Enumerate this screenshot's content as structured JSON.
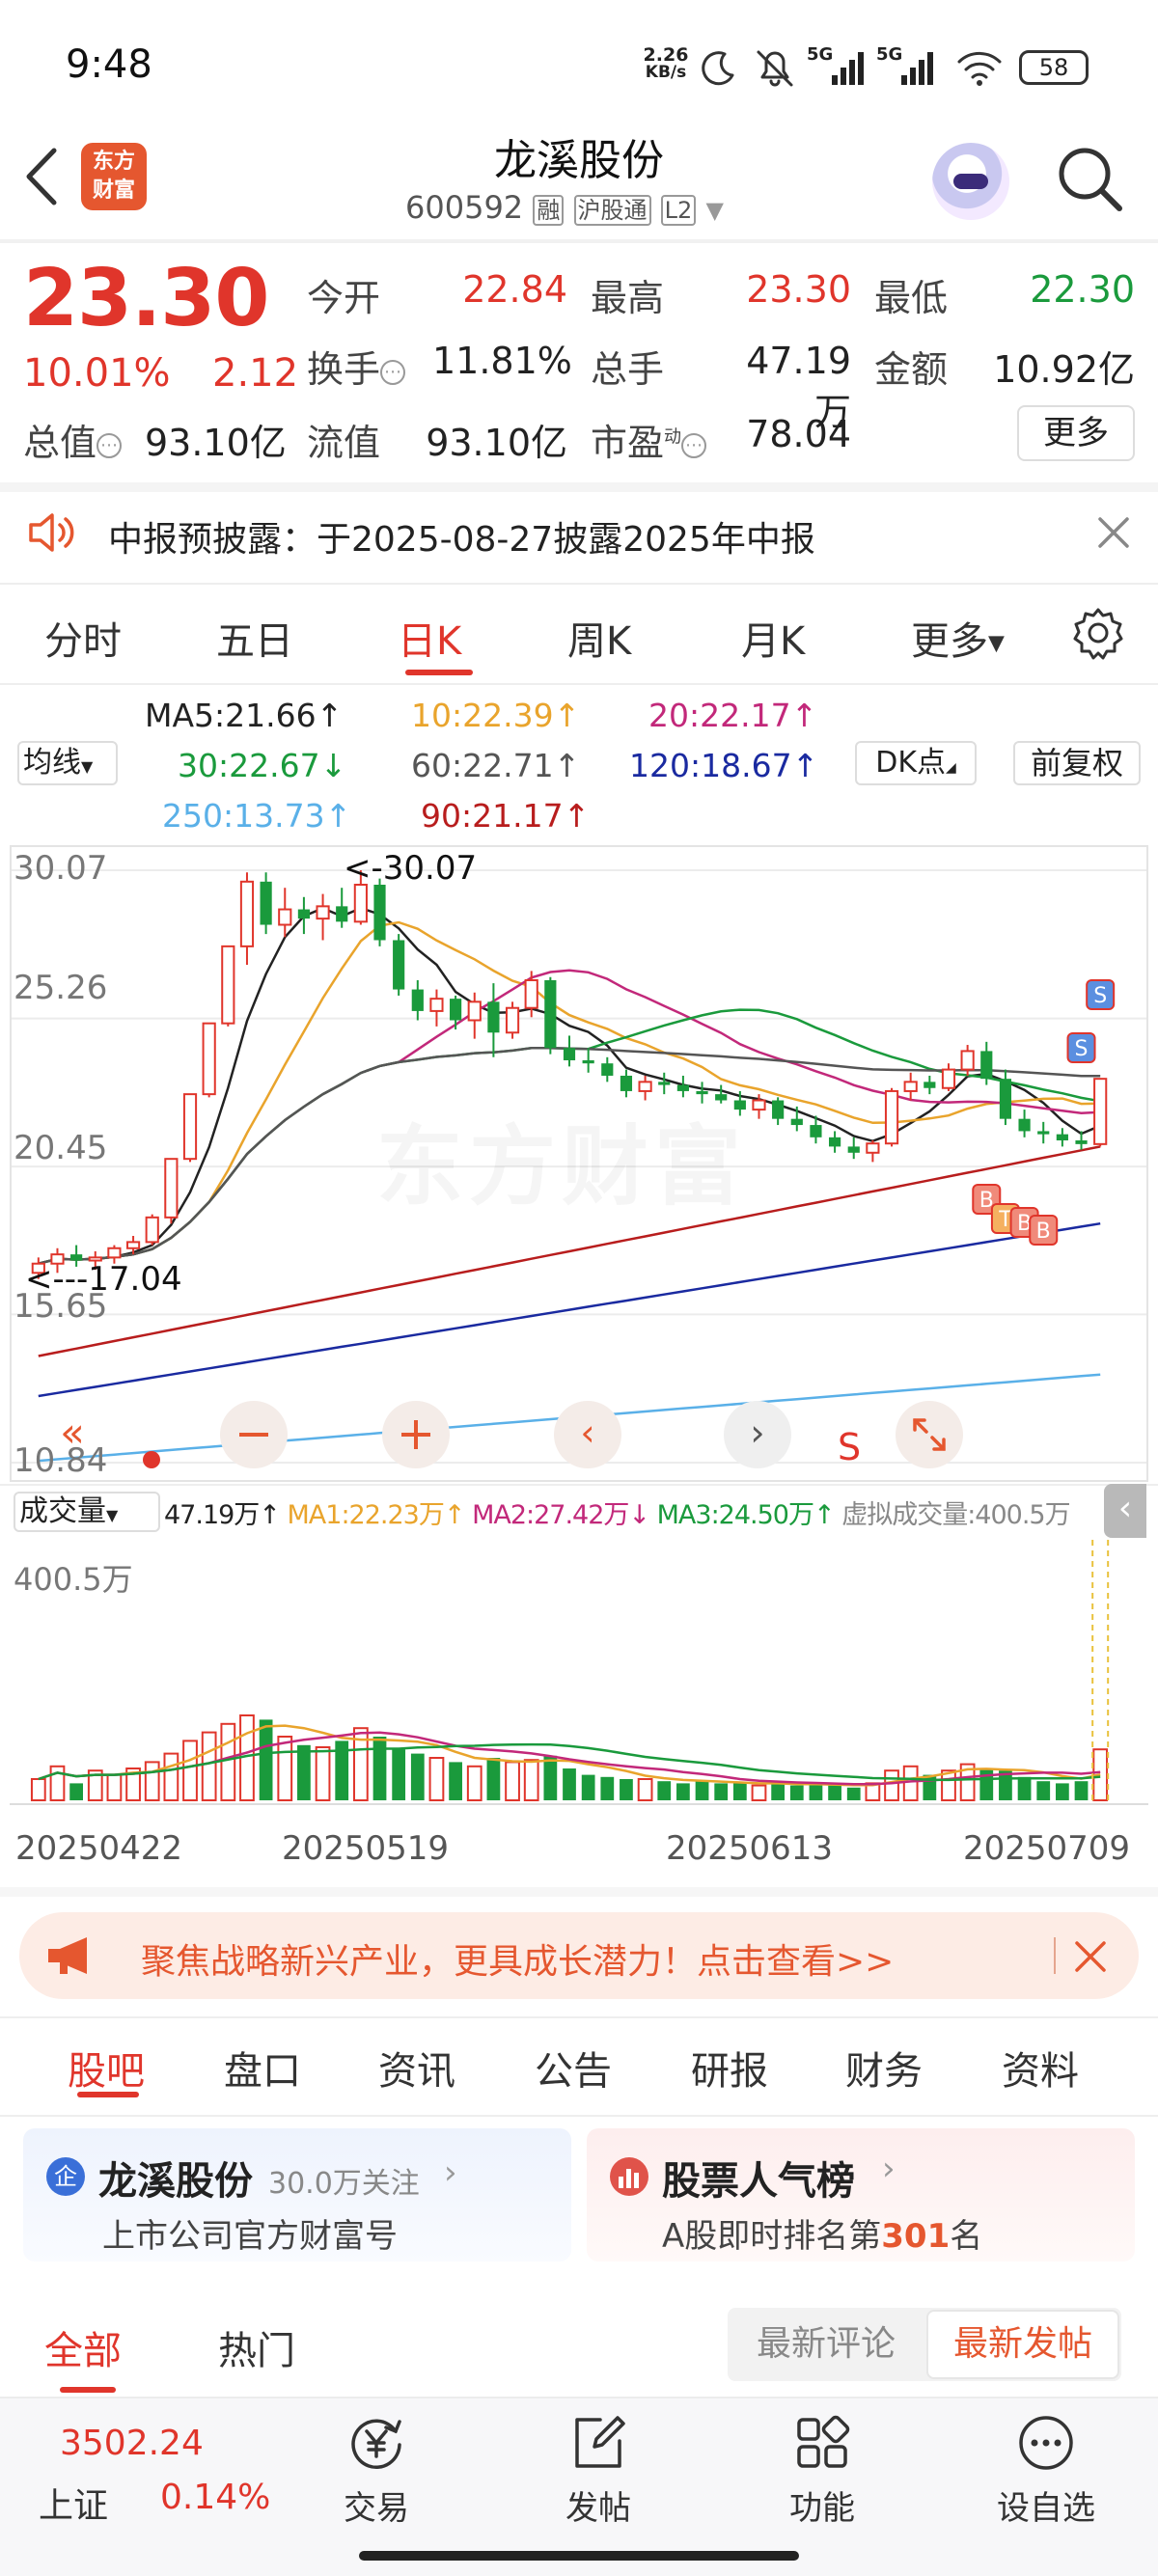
{
  "status_bar": {
    "time": "9:48",
    "net_speed_top": "2.26",
    "net_speed_bottom": "KB/s",
    "battery": "58",
    "sig1": "5G",
    "sig2": "5G"
  },
  "header": {
    "app_logo_top": "东方",
    "app_logo_bottom": "财富",
    "stock_name": "龙溪股份",
    "stock_code": "600592",
    "tag_rong": "融",
    "tag_hgt": "沪股通",
    "tag_l2": "L2"
  },
  "quote": {
    "price": "23.30",
    "change_pct": "10.01%",
    "change_amt": "2.12",
    "open_label": "今开",
    "open": "22.84",
    "high_label": "最高",
    "high": "23.30",
    "low_label": "最低",
    "low": "22.30",
    "turnover_label": "换手",
    "turnover": "11.81%",
    "volume_label": "总手",
    "volume": "47.19万",
    "amount_label": "金额",
    "amount": "10.92亿",
    "mcap_label": "总值",
    "mcap": "93.10亿",
    "float_label": "流值",
    "float": "93.10亿",
    "pe_label": "市盈",
    "pe_sup": "动",
    "pe": "78.04",
    "more_button": "更多"
  },
  "notice": {
    "text": "中报预披露：于2025-08-27披露2025年中报"
  },
  "period_tabs": [
    "分时",
    "五日",
    "日K",
    "周K",
    "月K",
    "更多"
  ],
  "active_tab": "日K",
  "ma": {
    "ma_type": "均线",
    "ma5": "MA5:21.66↑",
    "ma10": "10:22.39↑",
    "ma20": "20:22.17↑",
    "ma30": "30:22.67↓",
    "ma60": "60:22.71↑",
    "ma120": "120:18.67↑",
    "ma250": "250:13.73↑",
    "ma90": "90:21.17↑",
    "dk_button": "DK点",
    "adjust_button": "前复权"
  },
  "chart_data": {
    "type": "candlestick",
    "price_axis_ticks": [
      "30.07",
      "25.26",
      "20.45",
      "15.65",
      "10.84"
    ],
    "ylim": [
      10.84,
      30.07
    ],
    "max_marker": "<-30.07",
    "min_marker": "<---17.04",
    "watermark": "东方财富",
    "date_labels": [
      "20250422",
      "20250519",
      "20250613",
      "20250709"
    ],
    "candles": [
      [
        17.0,
        17.5,
        16.8,
        17.3
      ],
      [
        17.3,
        17.8,
        17.0,
        17.6
      ],
      [
        17.6,
        17.9,
        17.2,
        17.4
      ],
      [
        17.4,
        17.7,
        17.1,
        17.5
      ],
      [
        17.5,
        17.9,
        17.3,
        17.8
      ],
      [
        17.8,
        18.2,
        17.6,
        18.0
      ],
      [
        18.0,
        18.9,
        17.9,
        18.8
      ],
      [
        18.8,
        20.7,
        18.6,
        20.7
      ],
      [
        20.7,
        22.8,
        20.6,
        22.8
      ],
      [
        22.8,
        25.1,
        22.7,
        25.1
      ],
      [
        25.1,
        27.6,
        25.0,
        27.6
      ],
      [
        27.6,
        30.0,
        27.0,
        29.7
      ],
      [
        29.7,
        30.0,
        28.0,
        28.3
      ],
      [
        28.3,
        29.5,
        27.9,
        28.8
      ],
      [
        28.8,
        29.2,
        28.0,
        28.5
      ],
      [
        28.5,
        29.3,
        27.8,
        28.9
      ],
      [
        28.9,
        29.5,
        28.2,
        28.4
      ],
      [
        28.4,
        30.07,
        28.3,
        29.6
      ],
      [
        29.6,
        29.8,
        27.6,
        27.8
      ],
      [
        27.8,
        28.0,
        26.0,
        26.2
      ],
      [
        26.2,
        26.5,
        25.2,
        25.5
      ],
      [
        25.5,
        26.2,
        25.0,
        25.9
      ],
      [
        25.9,
        26.0,
        24.9,
        25.2
      ],
      [
        25.2,
        26.1,
        24.6,
        25.8
      ],
      [
        25.8,
        26.4,
        24.0,
        24.8
      ],
      [
        24.8,
        25.8,
        24.6,
        25.6
      ],
      [
        25.6,
        26.8,
        25.3,
        26.5
      ],
      [
        26.5,
        26.6,
        24.1,
        24.3
      ],
      [
        24.3,
        24.7,
        23.7,
        23.9
      ],
      [
        23.9,
        24.3,
        23.5,
        23.8
      ],
      [
        23.8,
        24.0,
        23.2,
        23.4
      ],
      [
        23.4,
        23.6,
        22.7,
        22.9
      ],
      [
        22.9,
        23.4,
        22.6,
        23.2
      ],
      [
        23.2,
        23.5,
        22.8,
        23.1
      ],
      [
        23.1,
        23.4,
        22.7,
        22.9
      ],
      [
        22.9,
        23.2,
        22.5,
        22.8
      ],
      [
        22.8,
        23.1,
        22.5,
        22.6
      ],
      [
        22.6,
        22.9,
        22.1,
        22.3
      ],
      [
        22.3,
        22.8,
        22.0,
        22.6
      ],
      [
        22.6,
        22.7,
        21.8,
        22.0
      ],
      [
        22.0,
        22.4,
        21.6,
        21.8
      ],
      [
        21.8,
        22.1,
        21.2,
        21.4
      ],
      [
        21.4,
        21.6,
        20.9,
        21.1
      ],
      [
        21.1,
        21.4,
        20.7,
        20.9
      ],
      [
        20.9,
        21.3,
        20.6,
        21.2
      ],
      [
        21.2,
        23.0,
        21.1,
        22.9
      ],
      [
        22.9,
        23.5,
        22.6,
        23.2
      ],
      [
        23.2,
        23.4,
        22.8,
        23.0
      ],
      [
        23.0,
        23.8,
        22.9,
        23.6
      ],
      [
        23.6,
        24.4,
        23.4,
        24.2
      ],
      [
        24.2,
        24.5,
        23.1,
        23.3
      ],
      [
        23.3,
        23.6,
        21.8,
        22.0
      ],
      [
        22.0,
        22.3,
        21.4,
        21.6
      ],
      [
        21.6,
        21.9,
        21.2,
        21.5
      ],
      [
        21.5,
        21.7,
        21.1,
        21.3
      ],
      [
        21.3,
        21.6,
        21.0,
        21.18
      ],
      [
        21.18,
        23.3,
        21.1,
        23.3
      ]
    ]
  },
  "chart_controls": {
    "s_marker": "S"
  },
  "volume": {
    "label": "成交量",
    "vol": "47.19万↑",
    "ma1": "MA1:22.23万↑",
    "ma2": "MA2:27.42万↓",
    "ma3": "MA3:24.50万↑",
    "virtual": "虚拟成交量:400.5万",
    "max_tick": "400.5万",
    "bars": [
      0.1,
      0.16,
      0.08,
      0.14,
      0.12,
      0.15,
      0.18,
      0.22,
      0.28,
      0.32,
      0.36,
      0.4,
      0.38,
      0.3,
      0.26,
      0.25,
      0.28,
      0.34,
      0.3,
      0.24,
      0.22,
      0.2,
      0.18,
      0.16,
      0.2,
      0.18,
      0.19,
      0.21,
      0.15,
      0.12,
      0.11,
      0.1,
      0.1,
      0.09,
      0.08,
      0.09,
      0.08,
      0.08,
      0.07,
      0.08,
      0.07,
      0.08,
      0.07,
      0.06,
      0.08,
      0.14,
      0.16,
      0.12,
      0.14,
      0.17,
      0.15,
      0.14,
      0.11,
      0.09,
      0.08,
      0.09,
      0.24
    ]
  },
  "banner": {
    "text": "聚焦战略新兴产业，更具成长潜力！点击查看>>"
  },
  "section_tabs": [
    "股吧",
    "盘口",
    "资讯",
    "公告",
    "研报",
    "财务",
    "资料"
  ],
  "cards": {
    "official": {
      "name": "龙溪股份",
      "followers": "30.0万关注",
      "desc": "上市公司官方财富号"
    },
    "rank": {
      "title": "股票人气榜",
      "desc_prefix": "A股即时排名第",
      "rank": "301",
      "desc_suffix": "名"
    }
  },
  "feed_tabs": {
    "all": "全部",
    "hot": "热门",
    "latest_comment": "最新评论",
    "latest_post": "最新发帖"
  },
  "bottom_bar": {
    "index_value": "3502.24",
    "index_name": "上证",
    "index_change": "0.14%",
    "trade": "交易",
    "post": "发帖",
    "func": "功能",
    "watch": "设自选"
  },
  "colors": {
    "up": "#e0352b",
    "down": "#1a9a3c",
    "accent": "#e5572f"
  }
}
